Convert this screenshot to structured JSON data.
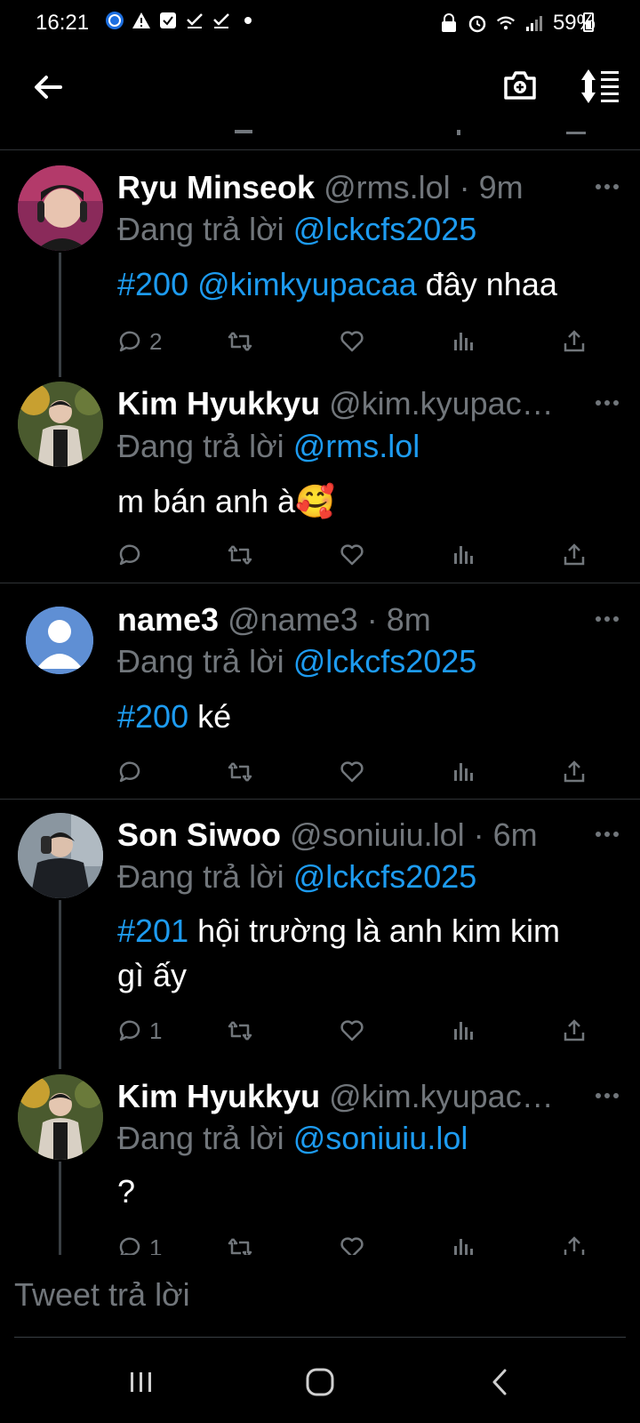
{
  "status_bar": {
    "time": "16:21",
    "battery": "59%",
    "icons": [
      "app-icon",
      "warning-icon",
      "checkbox-icon",
      "check-icon",
      "check-icon",
      "dot-icon",
      "lock-icon",
      "alarm-icon",
      "wifi-icon",
      "signal-icon",
      "battery-icon"
    ]
  },
  "topbar": {
    "icons": [
      "back-arrow-icon",
      "camera-add-icon",
      "sort-icon"
    ]
  },
  "tweets": [
    {
      "name": "Ryu Minseok",
      "handle": "@rms.lol · 9m",
      "reply_prefix": "Đang trả lời ",
      "reply_to": "@lckcfs2025",
      "body_tag": "#200",
      "body_mention": " @kimkyupacaa",
      "body_text": " đây nhaa",
      "reply_count": "2"
    },
    {
      "name": "Kim Hyukkyu",
      "handle": "@kim.kyupac…",
      "reply_prefix": "Đang trả lời ",
      "reply_to": "@rms.lol",
      "body_text": "m bán anh à🥰",
      "reply_count": ""
    },
    {
      "name": "name3",
      "handle": "@name3 · 8m",
      "reply_prefix": "Đang trả lời ",
      "reply_to": "@lckcfs2025",
      "body_tag": "#200",
      "body_text": " ké",
      "reply_count": ""
    },
    {
      "name": "Son Siwoo",
      "handle": "@soniuiu.lol · 6m",
      "reply_prefix": "Đang trả lời ",
      "reply_to": "@lckcfs2025",
      "body_tag": "#201",
      "body_text": " hội trường là anh kim kim gì ấy",
      "reply_count": "1"
    },
    {
      "name": "Kim Hyukkyu",
      "handle": "@kim.kyupac…",
      "reply_prefix": "Đang trả lời ",
      "reply_to": "@soniuiu.lol",
      "body_text": "?",
      "reply_count": "1"
    }
  ],
  "composer": {
    "placeholder": "Tweet trả lời"
  },
  "colors": {
    "background": "#000000",
    "accent": "#1d9bf0",
    "muted": "#71767b",
    "divider": "#2f3336"
  }
}
